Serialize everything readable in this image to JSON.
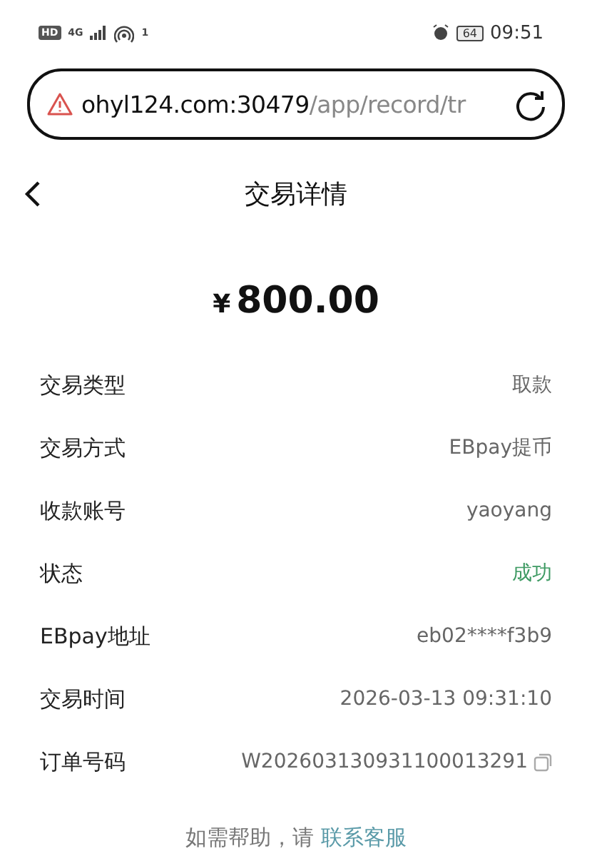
{
  "status_bar": {
    "network_badge": "HD",
    "network_type": "4G",
    "hotspot_count": "1",
    "battery": "64",
    "time": "09:51"
  },
  "address_bar": {
    "host": "ohyl124.com:30479",
    "path": "/app/record/tr"
  },
  "header": {
    "title": "交易详情"
  },
  "amount": {
    "currency": "¥",
    "value": "800.00"
  },
  "rows": [
    {
      "kind": "plain",
      "label": "交易类型",
      "value": "取款"
    },
    {
      "kind": "plain",
      "label": "交易方式",
      "value": "EBpay提币"
    },
    {
      "kind": "plain",
      "label": "收款账号",
      "value": "yaoyang"
    },
    {
      "kind": "status",
      "label": "状态",
      "value": "成功"
    },
    {
      "kind": "plain",
      "label": "EBpay地址",
      "value": "eb02****f3b9"
    },
    {
      "kind": "plain",
      "label": "交易时间",
      "value": "2026-03-13 09:31:10"
    },
    {
      "kind": "copy",
      "label": "订单号码",
      "value": "W202603130931100013291"
    }
  ],
  "help": {
    "text": "如需帮助，请",
    "link": "联系客服"
  }
}
